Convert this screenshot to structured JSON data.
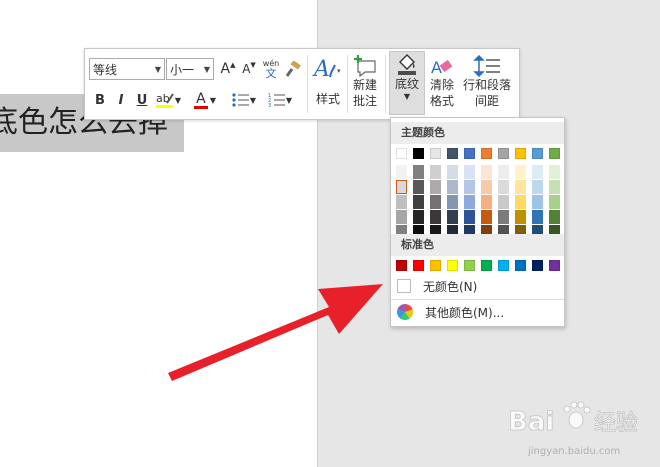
{
  "document": {
    "text": "底色怎么去掉"
  },
  "toolbar": {
    "font_name": "等线",
    "font_size": "小一",
    "grow_font_label": "A",
    "shrink_font_label": "A",
    "phonetic_top": "wén",
    "phonetic_bottom": "文",
    "bold": "B",
    "italic": "I",
    "underline": "U",
    "font_color_label": "A",
    "styles_label": "样式",
    "new_comment_line1": "新建",
    "new_comment_line2": "批注",
    "shading_label": "底纹",
    "clear_format_line1": "清除",
    "clear_format_line2": "格式",
    "spacing_line1": "行和段落",
    "spacing_line2": "间距"
  },
  "color_menu": {
    "theme_heading": "主题颜色",
    "standard_heading": "标准色",
    "no_color": "无颜色(N)",
    "more_colors": "其他颜色(M)...",
    "theme_top_row": [
      "#ffffff",
      "#000000",
      "#e7e6e6",
      "#44546a",
      "#4472c4",
      "#ed7d31",
      "#a5a5a5",
      "#ffc000",
      "#5b9bd5",
      "#70ad47"
    ],
    "theme_shades": [
      [
        "#f2f2f2",
        "#d9d9d9",
        "#bfbfbf",
        "#a6a6a6",
        "#808080"
      ],
      [
        "#808080",
        "#595959",
        "#404040",
        "#262626",
        "#0d0d0d"
      ],
      [
        "#d0cece",
        "#aeaaaa",
        "#757171",
        "#3a3838",
        "#171616"
      ],
      [
        "#d6dce4",
        "#adb9ca",
        "#8496b0",
        "#333f4f",
        "#222a35"
      ],
      [
        "#d9e2f3",
        "#b4c6e7",
        "#8eaadb",
        "#2f5496",
        "#1f3864"
      ],
      [
        "#fbe5d5",
        "#f7caac",
        "#f4b083",
        "#c55a11",
        "#833c0b"
      ],
      [
        "#ededed",
        "#dbdbdb",
        "#c9c9c9",
        "#7b7b7b",
        "#525252"
      ],
      [
        "#fff2cc",
        "#fee599",
        "#ffd965",
        "#bf9000",
        "#7f6000"
      ],
      [
        "#deebf6",
        "#bdd7ee",
        "#9dc3e6",
        "#2e75b5",
        "#1e4e79"
      ],
      [
        "#e2efd9",
        "#c5e0b3",
        "#a8d08d",
        "#538135",
        "#375623"
      ]
    ],
    "standard_colors": [
      "#c00000",
      "#ff0000",
      "#ffc000",
      "#ffff00",
      "#92d050",
      "#00b050",
      "#00b0f0",
      "#0070c0",
      "#002060",
      "#7030a0"
    ],
    "selected_theme_index": [
      0,
      1
    ],
    "arrow_color": "#e8202a"
  },
  "watermark": {
    "brand": "Baidu",
    "brand_cn": "经验",
    "url": "jingyan.baidu.com"
  }
}
